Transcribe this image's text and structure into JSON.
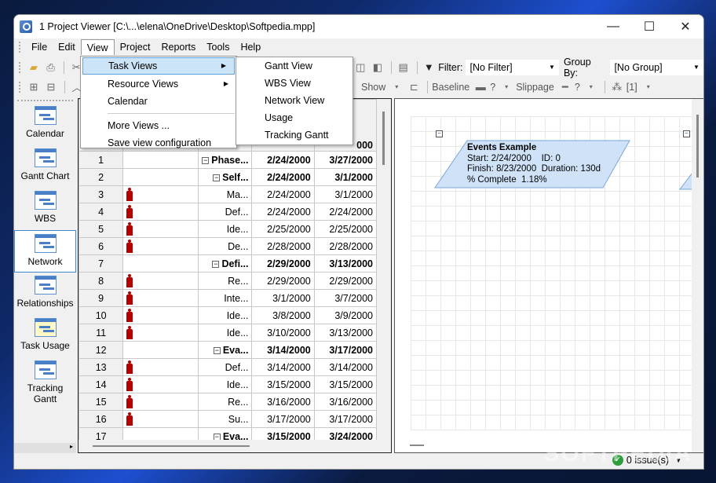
{
  "window": {
    "title": "1 Project Viewer [C:\\...\\elena\\OneDrive\\Desktop\\Softpedia.mpp]",
    "minimize": "—",
    "maximize": "☐",
    "close": "✕"
  },
  "menubar": [
    "File",
    "Edit",
    "View",
    "Project",
    "Reports",
    "Tools",
    "Help"
  ],
  "toolbar": {
    "filter_label": "Filter:",
    "filter_value": "[No Filter]",
    "group_label": "Group By:",
    "group_value": "[No Group]",
    "show_label": "Show",
    "baseline_label": "Baseline",
    "baseline_value": "?",
    "slippage_label": "Slippage",
    "slippage_value": "?",
    "level_value": "[1]"
  },
  "view_menu": {
    "items": [
      "Task Views",
      "Resource Views",
      "Calendar",
      "More Views ...",
      "Save view configuration"
    ],
    "highlighted": "Task Views"
  },
  "task_views_menu": [
    "Gantt View",
    "WBS View",
    "Network View",
    "Usage",
    "Tracking Gantt"
  ],
  "sidebar": [
    {
      "label": "Calendar",
      "icon": "calendar-icon"
    },
    {
      "label": "Gantt Chart",
      "icon": "gantt-chart-icon"
    },
    {
      "label": "WBS",
      "icon": "wbs-icon"
    },
    {
      "label": "Network",
      "icon": "network-icon",
      "active": true
    },
    {
      "label": "Relationships",
      "icon": "relationships-icon"
    },
    {
      "label": "Task Usage",
      "icon": "task-usage-icon"
    },
    {
      "label": "Tracking Gantt",
      "icon": "tracking-gantt-icon"
    }
  ],
  "grid": {
    "header_partial": "000",
    "rows": [
      {
        "id": "1",
        "name": "Phase...",
        "start": "2/24/2000",
        "finish": "3/27/2000",
        "summary": true
      },
      {
        "id": "2",
        "name": "Self...",
        "start": "2/24/2000",
        "finish": "3/1/2000",
        "summary": true
      },
      {
        "id": "3",
        "name": "Ma...",
        "start": "2/24/2000",
        "finish": "3/1/2000",
        "resource": true
      },
      {
        "id": "4",
        "name": "Def...",
        "start": "2/24/2000",
        "finish": "2/24/2000",
        "resource": true
      },
      {
        "id": "5",
        "name": "Ide...",
        "start": "2/25/2000",
        "finish": "2/25/2000",
        "resource": true
      },
      {
        "id": "6",
        "name": "De...",
        "start": "2/28/2000",
        "finish": "2/28/2000",
        "resource": true
      },
      {
        "id": "7",
        "name": "Defi...",
        "start": "2/29/2000",
        "finish": "3/13/2000",
        "summary": true
      },
      {
        "id": "8",
        "name": "Re...",
        "start": "2/29/2000",
        "finish": "2/29/2000",
        "resource": true
      },
      {
        "id": "9",
        "name": "Inte...",
        "start": "3/1/2000",
        "finish": "3/7/2000",
        "resource": true
      },
      {
        "id": "10",
        "name": "Ide...",
        "start": "3/8/2000",
        "finish": "3/9/2000",
        "resource": true
      },
      {
        "id": "11",
        "name": "Ide...",
        "start": "3/10/2000",
        "finish": "3/13/2000",
        "resource": true
      },
      {
        "id": "12",
        "name": "Eva...",
        "start": "3/14/2000",
        "finish": "3/17/2000",
        "summary": true
      },
      {
        "id": "13",
        "name": "Def...",
        "start": "3/14/2000",
        "finish": "3/14/2000",
        "resource": true
      },
      {
        "id": "14",
        "name": "Ide...",
        "start": "3/15/2000",
        "finish": "3/15/2000",
        "resource": true
      },
      {
        "id": "15",
        "name": "Re...",
        "start": "3/16/2000",
        "finish": "3/16/2000",
        "resource": true
      },
      {
        "id": "16",
        "name": "Su...",
        "start": "3/17/2000",
        "finish": "3/17/2000",
        "resource": true
      },
      {
        "id": "17",
        "name": "Eva...",
        "start": "3/15/2000",
        "finish": "3/24/2000",
        "summary": true
      }
    ]
  },
  "network_node": {
    "title": "Events Example",
    "line1": "Start: 2/24/2000    ID: 0",
    "line2": "Finish: 8/23/2000  Duration: 130d",
    "line3": "% Complete  1.18%"
  },
  "statusbar": {
    "issues": "0 issue(s)"
  },
  "colors": {
    "resource_icon": "#b30000",
    "node_fill": "#cfe2f7",
    "menu_highlight": "#cce4f7"
  },
  "watermark": "SOFTPEDIA"
}
